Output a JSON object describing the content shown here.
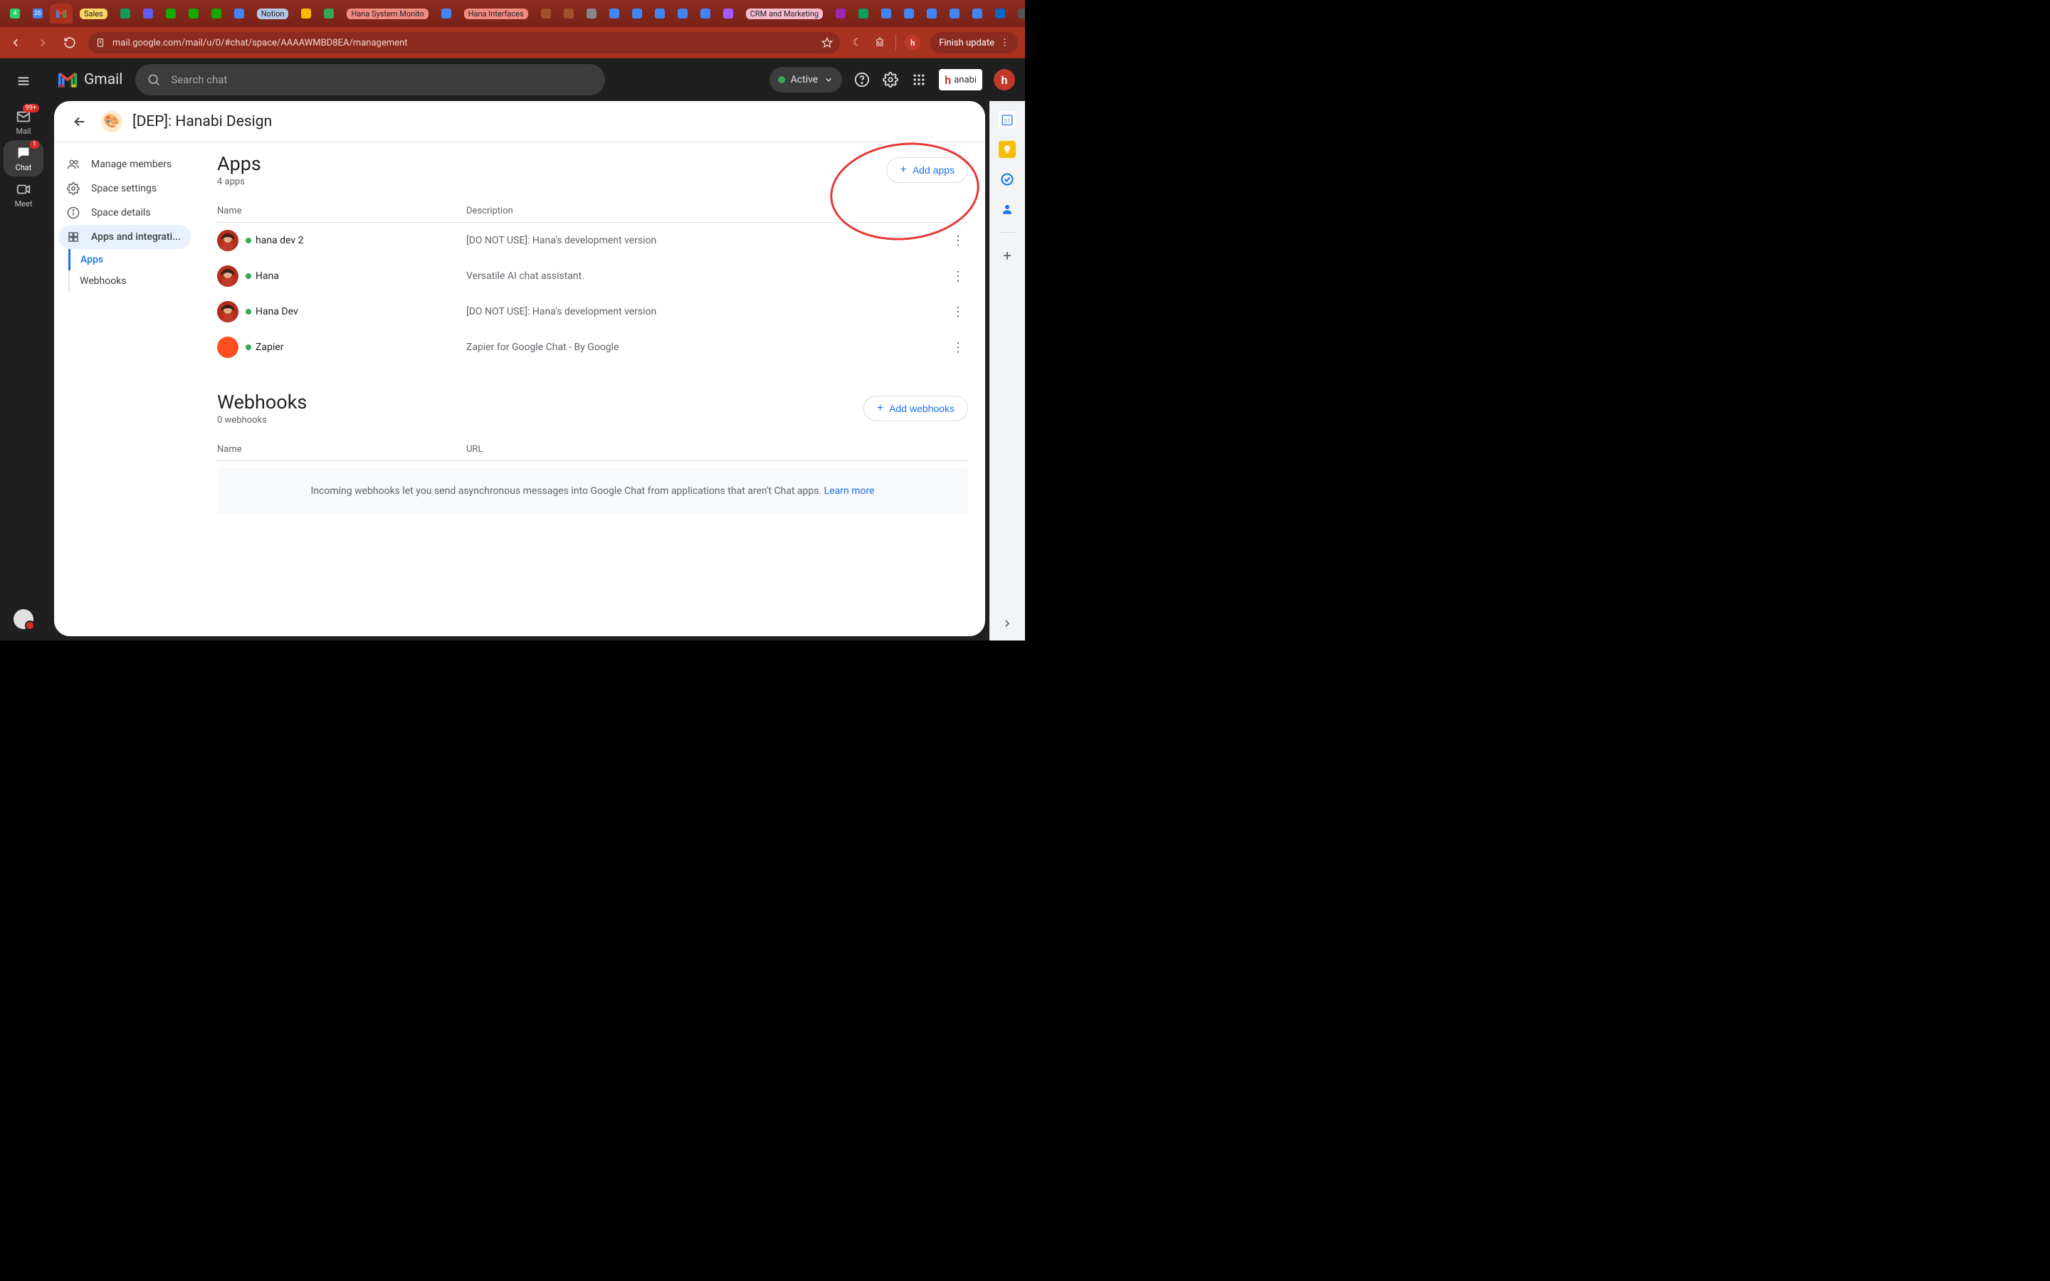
{
  "browser": {
    "tabs": [
      {
        "label": "",
        "icon": "wa",
        "badge": "4",
        "color": "#25d366"
      },
      {
        "label": "",
        "icon": "cal",
        "badge": "26",
        "color": "#4285f4"
      },
      {
        "label": "",
        "icon": "gmail"
      },
      {
        "label": "Sales",
        "chip": true,
        "chipBg": "#fdd663",
        "chipColor": "#202124"
      },
      {
        "label": "",
        "icon": "sheets",
        "color": "#0f9d58"
      },
      {
        "label": "",
        "icon": "loom",
        "color": "#625df5"
      },
      {
        "label": "",
        "icon": "up",
        "color": "#14a800"
      },
      {
        "label": "",
        "icon": "up",
        "color": "#14a800"
      },
      {
        "label": "",
        "icon": "up",
        "color": "#14a800"
      },
      {
        "label": "",
        "icon": "docs",
        "color": "#4285f4"
      },
      {
        "label": "Notion",
        "chip": true,
        "chipBg": "#b4c7e7",
        "chipColor": "#202124"
      },
      {
        "label": "",
        "icon": "link",
        "color": "#fbbc04"
      },
      {
        "label": "",
        "icon": "check",
        "color": "#34a853"
      },
      {
        "label": "Hana System Monito",
        "chip": true,
        "chipBg": "#f28b82",
        "chipColor": "#202124"
      },
      {
        "label": "",
        "icon": "docs",
        "color": "#4285f4"
      },
      {
        "label": "Hana Interfaces",
        "chip": true,
        "chipBg": "#f28b82",
        "chipColor": "#202124"
      },
      {
        "label": "",
        "icon": "person",
        "color": "#a0522d"
      },
      {
        "label": "",
        "icon": "person",
        "color": "#a0522d"
      },
      {
        "label": "",
        "icon": "grid",
        "color": "#888"
      },
      {
        "label": "",
        "icon": "docs",
        "color": "#4285f4"
      },
      {
        "label": "",
        "icon": "docs",
        "color": "#4285f4"
      },
      {
        "label": "",
        "icon": "docs",
        "color": "#4285f4"
      },
      {
        "label": "",
        "icon": "docs",
        "color": "#4285f4"
      },
      {
        "label": "",
        "icon": "docs",
        "color": "#4285f4"
      },
      {
        "label": "",
        "icon": "figma",
        "color": "#a259ff"
      },
      {
        "label": "CRM and Marketing",
        "chip": true,
        "chipBg": "#f8bbd0",
        "chipColor": "#202124"
      },
      {
        "label": "",
        "icon": "dot",
        "color": "#9c27b0"
      },
      {
        "label": "",
        "icon": "loom",
        "color": "#0f9d58"
      },
      {
        "label": "",
        "icon": "g",
        "color": "#4285f4"
      },
      {
        "label": "",
        "icon": "loom",
        "color": "#4285f4"
      },
      {
        "label": "",
        "icon": "g",
        "color": "#4285f4"
      },
      {
        "label": "",
        "icon": "loom",
        "color": "#4285f4"
      },
      {
        "label": "",
        "icon": "g",
        "color": "#4285f4"
      },
      {
        "label": "",
        "icon": "in",
        "color": "#0a66c2"
      },
      {
        "label": "",
        "icon": "dot",
        "color": "#555"
      }
    ],
    "activeTabIndex": 2,
    "url": "mail.google.com/mail/u/0/#chat/space/AAAAWMBD8EA/management",
    "finishUpdate": "Finish update"
  },
  "rail": {
    "items": [
      {
        "label": "Mail",
        "icon": "mail",
        "badge": "99+"
      },
      {
        "label": "Chat",
        "icon": "chat",
        "badge": "1",
        "active": true
      },
      {
        "label": "Meet",
        "icon": "meet"
      }
    ]
  },
  "topbar": {
    "appName": "Gmail",
    "searchPlaceholder": "Search chat",
    "statusLabel": "Active",
    "brand": "anabi"
  },
  "space": {
    "title": "[DEP]: Hanabi Design",
    "emoji": "🎨",
    "nav": [
      {
        "label": "Manage members",
        "icon": "people"
      },
      {
        "label": "Space settings",
        "icon": "gear"
      },
      {
        "label": "Space details",
        "icon": "info"
      },
      {
        "label": "Apps and integrati...",
        "icon": "grid",
        "active": true
      }
    ],
    "subnav": [
      {
        "label": "Apps",
        "selected": true
      },
      {
        "label": "Webhooks"
      }
    ]
  },
  "apps": {
    "title": "Apps",
    "count": "4 apps",
    "addLabel": "Add apps",
    "cols": {
      "name": "Name",
      "description": "Description"
    },
    "rows": [
      {
        "name": "hana dev 2",
        "desc": "[DO NOT USE]: Hana's development version",
        "avatar": "hana"
      },
      {
        "name": "Hana",
        "desc": "Versatile AI chat assistant.",
        "avatar": "hana"
      },
      {
        "name": "Hana Dev",
        "desc": "[DO NOT USE]: Hana's development version",
        "avatar": "hana"
      },
      {
        "name": "Zapier",
        "desc": "Zapier for Google Chat - By Google",
        "avatar": "zapier"
      }
    ]
  },
  "webhooks": {
    "title": "Webhooks",
    "count": "0 webhooks",
    "addLabel": "Add webhooks",
    "cols": {
      "name": "Name",
      "url": "URL"
    },
    "emptyText": "Incoming webhooks let you send asynchronous messages into Google Chat from applications that aren't Chat apps. ",
    "learnMore": "Learn more"
  },
  "annotation": {
    "circleHighlight": "add-apps-button"
  }
}
